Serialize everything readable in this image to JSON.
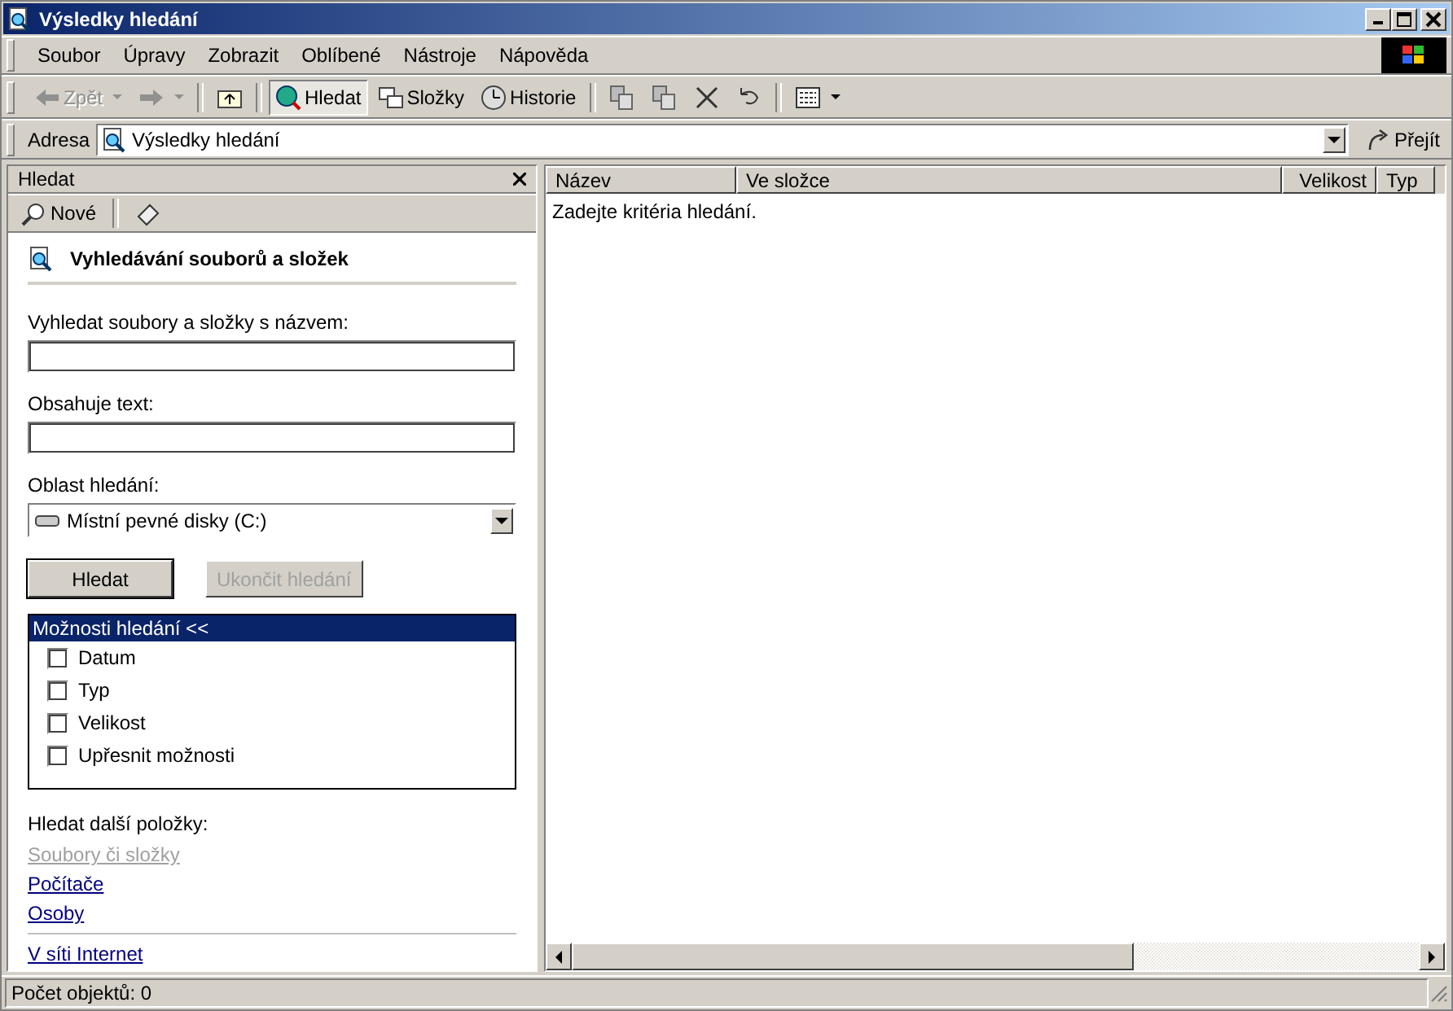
{
  "window": {
    "title": "Výsledky hledání"
  },
  "menu": [
    "Soubor",
    "Úpravy",
    "Zobrazit",
    "Oblíbené",
    "Nástroje",
    "Nápověda"
  ],
  "toolbar": [
    {
      "kind": "back",
      "label": "Zpět",
      "disabled": true
    },
    {
      "kind": "forward",
      "disabled": true
    },
    {
      "kind": "up"
    },
    {
      "kind": "search",
      "label": "Hledat",
      "selected": true
    },
    {
      "kind": "folders",
      "label": "Složky",
      "selected": false
    },
    {
      "kind": "history",
      "label": "Historie",
      "selected": false
    },
    {
      "kind": "move"
    },
    {
      "kind": "copy"
    },
    {
      "kind": "delete"
    },
    {
      "kind": "undo"
    },
    {
      "kind": "views"
    }
  ],
  "address": {
    "label": "Adresa",
    "value": "Výsledky hledání",
    "go": "Přejít"
  },
  "search_pane": {
    "title": "Hledat",
    "new_label": "Nové",
    "heading": "Vyhledávání souborů a složek",
    "name_label": "Vyhledat soubory a složky s názvem:",
    "text_label": "Obsahuje text:",
    "scope_label": "Oblast hledání:",
    "scope_value": "Místní pevné disky (C:)",
    "buttons": [
      {
        "label": "Hledat",
        "disabled": false
      },
      {
        "label": "Ukončit hledání",
        "disabled": true
      }
    ],
    "options": {
      "title": "Možnosti hledání <<",
      "items": [
        {
          "label": "Datum",
          "checked": false
        },
        {
          "label": "Typ",
          "checked": false
        },
        {
          "label": "Velikost",
          "checked": false
        },
        {
          "label": "Upřesnit možnosti",
          "checked": false
        }
      ]
    },
    "other_label": "Hledat další položky:",
    "links": [
      {
        "label": "Soubory či složky",
        "disabled": true
      },
      {
        "label": "Počítače",
        "disabled": false
      },
      {
        "label": "Osoby",
        "disabled": false
      }
    ],
    "internet_link": "V síti Internet"
  },
  "results": {
    "columns": [
      "Název",
      "Ve složce",
      "Velikost",
      "Typ"
    ],
    "message": "Zadejte kritéria hledání."
  },
  "status_bar": "Počet objektů: 0"
}
